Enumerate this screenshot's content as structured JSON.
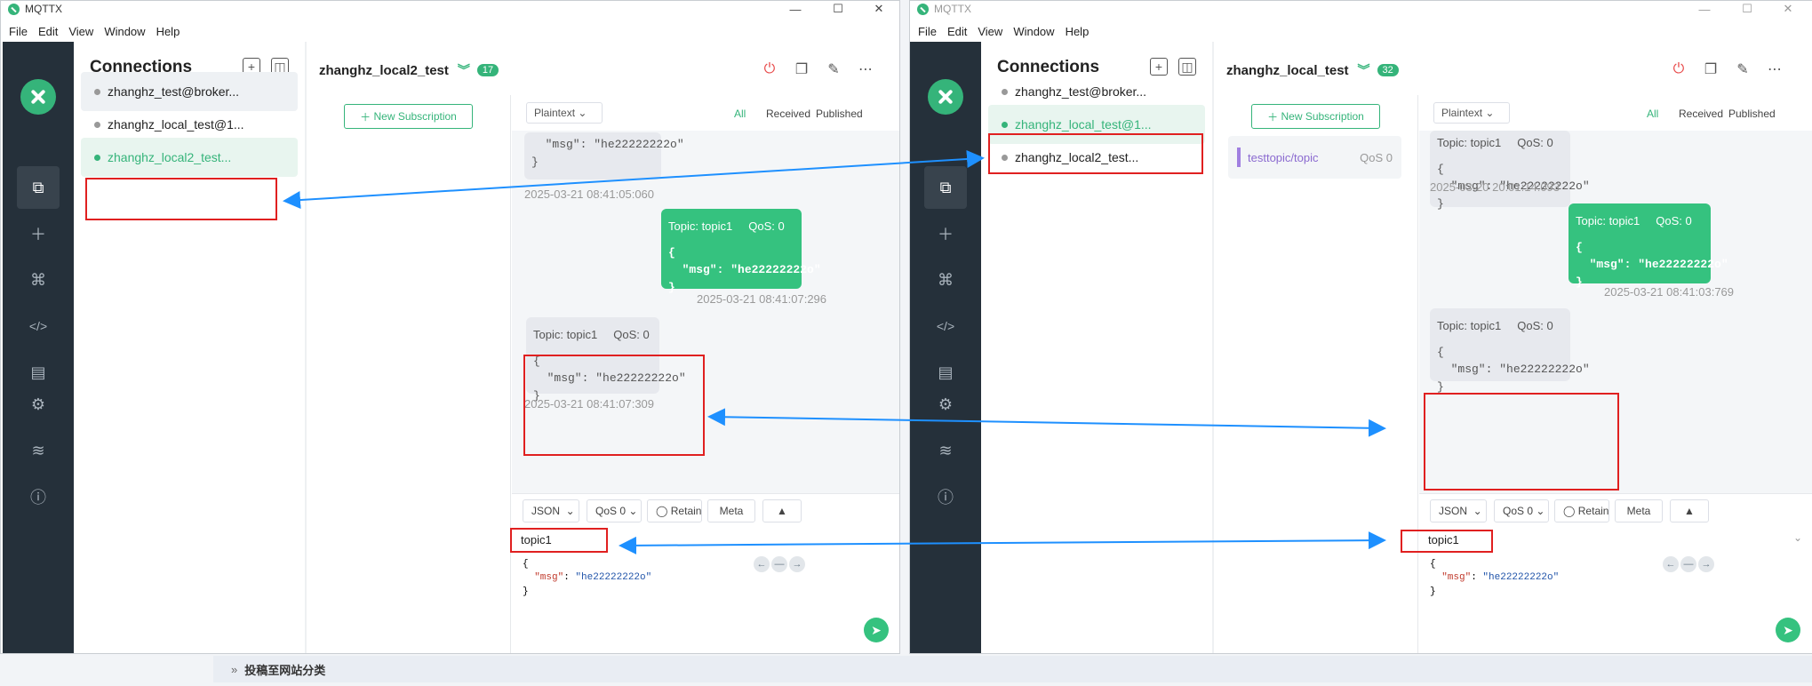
{
  "title": "MQTTX",
  "menu": [
    "File",
    "Edit",
    "View",
    "Window",
    "Help"
  ],
  "window_controls": {
    "minimize": "—",
    "maximize": "☐",
    "close": "✕"
  },
  "connections_title": "Connections",
  "left": {
    "connections": [
      "zhanghz_test@broker...",
      "zhanghz_local_test@1...",
      "zhanghz_local2_test..."
    ],
    "active_title": "zhanghz_local2_test",
    "badge": "17",
    "new_subscription": "New Subscription",
    "format": "Plaintext",
    "filters": [
      "All",
      "Received",
      "Published"
    ],
    "messages": [
      {
        "body": "  \"msg\": \"he22222222o\"\n}",
        "time": "2025-03-21 08:41:05:060"
      },
      {
        "topic": "Topic: topic1",
        "qos": "QoS: 0",
        "body": "{\n  \"msg\": \"he22222222o\"\n}",
        "time": "2025-03-21 08:41:07:296"
      },
      {
        "topic": "Topic: topic1",
        "qos": "QoS: 0",
        "body": "{\n  \"msg\": \"he22222222o\"\n}",
        "time": "2025-03-21 08:41:07:309"
      }
    ],
    "composer": {
      "format": "JSON",
      "qos": "QoS 0",
      "retain": "Retain",
      "meta": "Meta",
      "topic": "topic1",
      "payload_key": "\"msg\"",
      "payload_value": "\"he22222222o\""
    }
  },
  "right": {
    "connections": [
      "zhanghz_test@broker...",
      "zhanghz_local_test@1...",
      "zhanghz_local2_test..."
    ],
    "active_title": "zhanghz_local_test",
    "badge": "32",
    "new_subscription": "New Subscription",
    "subscription": {
      "topic": "testtopic/topic",
      "qos": "QoS 0"
    },
    "format": "Plaintext",
    "filters": [
      "All",
      "Received",
      "Published"
    ],
    "messages": [
      {
        "topic": "Topic: topic1",
        "qos": "QoS: 0",
        "body": "{\n  \"msg\": \"he22222222o\"\n}",
        "time": "2025-03-20 20:01:14:093"
      },
      {
        "topic": "Topic: topic1",
        "qos": "QoS: 0",
        "body": "{\n  \"msg\": \"he22222222o\"\n}",
        "time": "2025-03-21 08:41:03:769"
      },
      {
        "topic": "Topic: topic1",
        "qos": "QoS: 0",
        "body": "{\n  \"msg\": \"he22222222o\"\n}"
      }
    ],
    "composer": {
      "format": "JSON",
      "qos": "QoS 0",
      "retain": "Retain",
      "meta": "Meta",
      "topic": "topic1",
      "payload_key": "\"msg\"",
      "payload_value": "\"he22222222o\""
    }
  },
  "bottom_bar": "投稿至网站分类",
  "colors": {
    "accent": "#35b47a",
    "rail": "#25303a",
    "annotation_box": "#e02020",
    "annotation_arrow": "#1e90ff"
  }
}
